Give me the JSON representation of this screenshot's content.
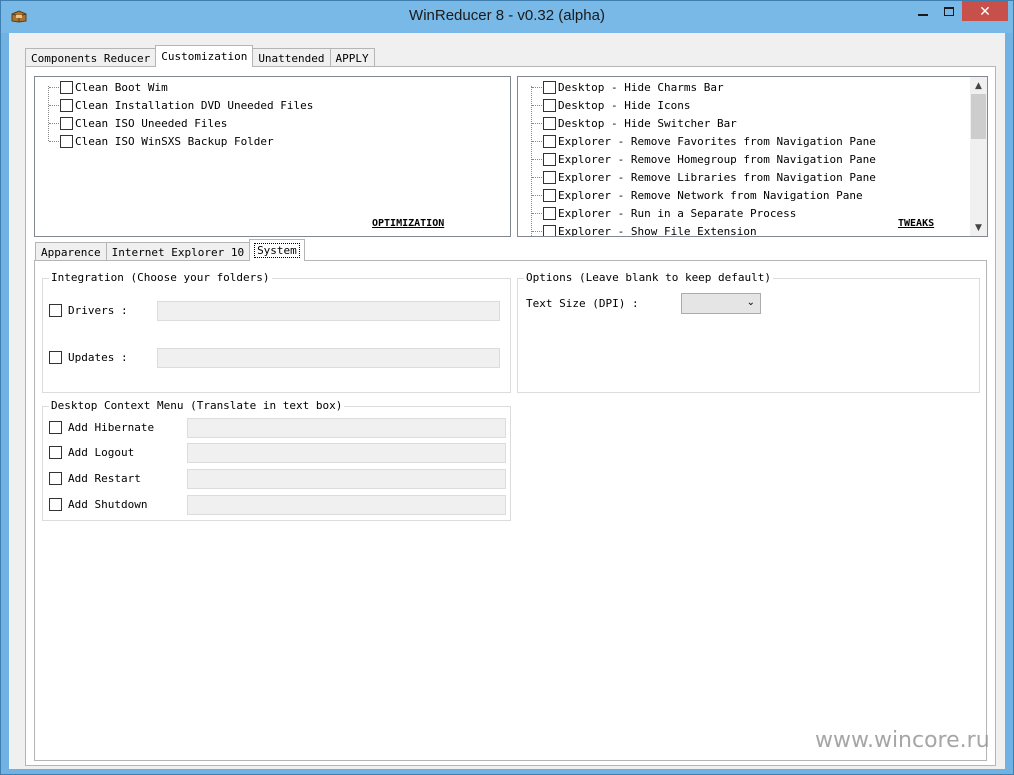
{
  "window": {
    "title": "WinReducer 8 - v0.32 (alpha)",
    "close_glyph": "✕"
  },
  "main_tabs": [
    {
      "label": "Components Reducer",
      "active": false
    },
    {
      "label": "Customization",
      "active": true
    },
    {
      "label": "Unattended",
      "active": false
    },
    {
      "label": "APPLY",
      "active": false
    }
  ],
  "optimization": {
    "caption": "OPTIMIZATION",
    "items": [
      "Clean Boot Wim",
      "Clean Installation DVD Uneeded Files",
      "Clean ISO Uneeded Files",
      "Clean ISO WinSXS Backup Folder"
    ]
  },
  "tweaks": {
    "caption": "TWEAKS",
    "items": [
      "Desktop - Hide Charms Bar",
      "Desktop - Hide Icons",
      "Desktop - Hide Switcher Bar",
      "Explorer - Remove Favorites from Navigation Pane",
      "Explorer - Remove Homegroup from Navigation Pane",
      "Explorer - Remove Libraries from Navigation Pane",
      "Explorer - Remove Network from Navigation Pane",
      "Explorer - Run in a Separate Process",
      "Explorer - Show File Extension"
    ]
  },
  "sub_tabs": [
    {
      "label": "Apparence",
      "active": false
    },
    {
      "label": "Internet Explorer 10",
      "active": false
    },
    {
      "label": "System",
      "active": true
    }
  ],
  "integration": {
    "title": "Integration (Choose your folders)",
    "drivers_label": "Drivers :",
    "updates_label": "Updates :",
    "drivers_value": "",
    "updates_value": ""
  },
  "options": {
    "title": "Options (Leave blank to keep default)",
    "text_size_label": "Text Size (DPI)  :",
    "text_size_value": ""
  },
  "context_menu": {
    "title": "Desktop Context Menu (Translate in text box)",
    "items": [
      "Add Hibernate",
      "Add Logout",
      "Add Restart",
      "Add Shutdown"
    ]
  },
  "watermark": "www.wincore.ru"
}
